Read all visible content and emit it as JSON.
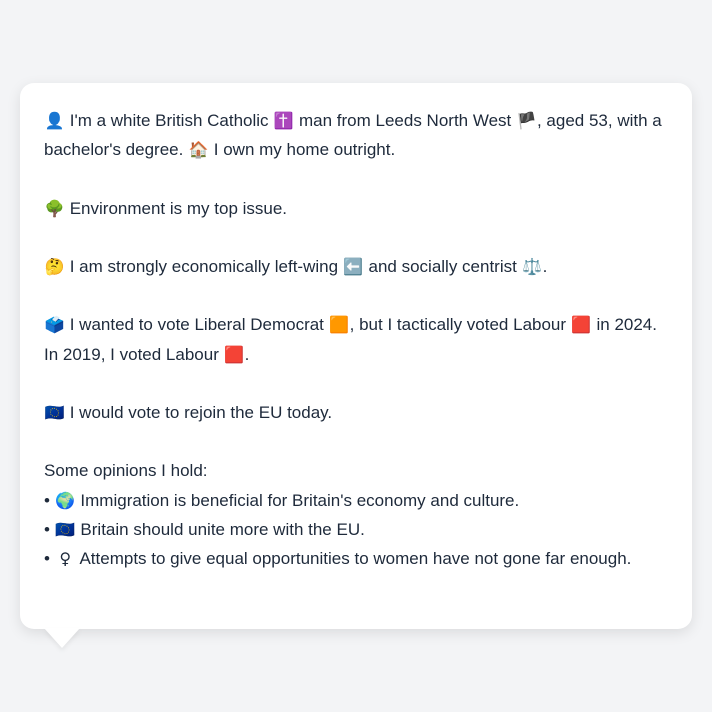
{
  "bio": {
    "p1": {
      "e1": "👤",
      "t1": " I'm a white British Catholic ",
      "e2": "✝️",
      "t2": " man from Leeds North West ",
      "e3": "🏴",
      "t3": ", aged 53, with a bachelor's degree. ",
      "e4": "🏠",
      "t4": " I own my home outright."
    },
    "p2": {
      "e1": "🌳",
      "t1": " Environment is my top issue."
    },
    "p3": {
      "e1": "🤔",
      "t1": " I am strongly economically left-wing ",
      "e2": "⬅️",
      "t2": " and socially centrist ",
      "e3": "⚖️",
      "t3": "."
    },
    "p4": {
      "e1": "🗳️",
      "t1": " I wanted to vote Liberal Democrat ",
      "e2": "🟧",
      "t2": ", but I tactically voted Labour ",
      "e3": "🟥",
      "t3": " in 2024. In 2019, I voted Labour ",
      "e4": "🟥",
      "t4": "."
    },
    "p5": {
      "e1": "🇪🇺",
      "t1": " I would vote to rejoin the EU today."
    },
    "opinions_heading": "Some opinions I hold:",
    "opinions": [
      {
        "bullet": "•",
        "emoji": "🌍",
        "text": " Immigration is beneficial for Britain's economy and culture."
      },
      {
        "bullet": "•",
        "emoji": "🇪🇺",
        "text": " Britain should unite more with the EU."
      },
      {
        "bullet": "•",
        "emoji": "♀",
        "text": "  Attempts to give equal opportunities to women have not gone far enough."
      }
    ]
  }
}
